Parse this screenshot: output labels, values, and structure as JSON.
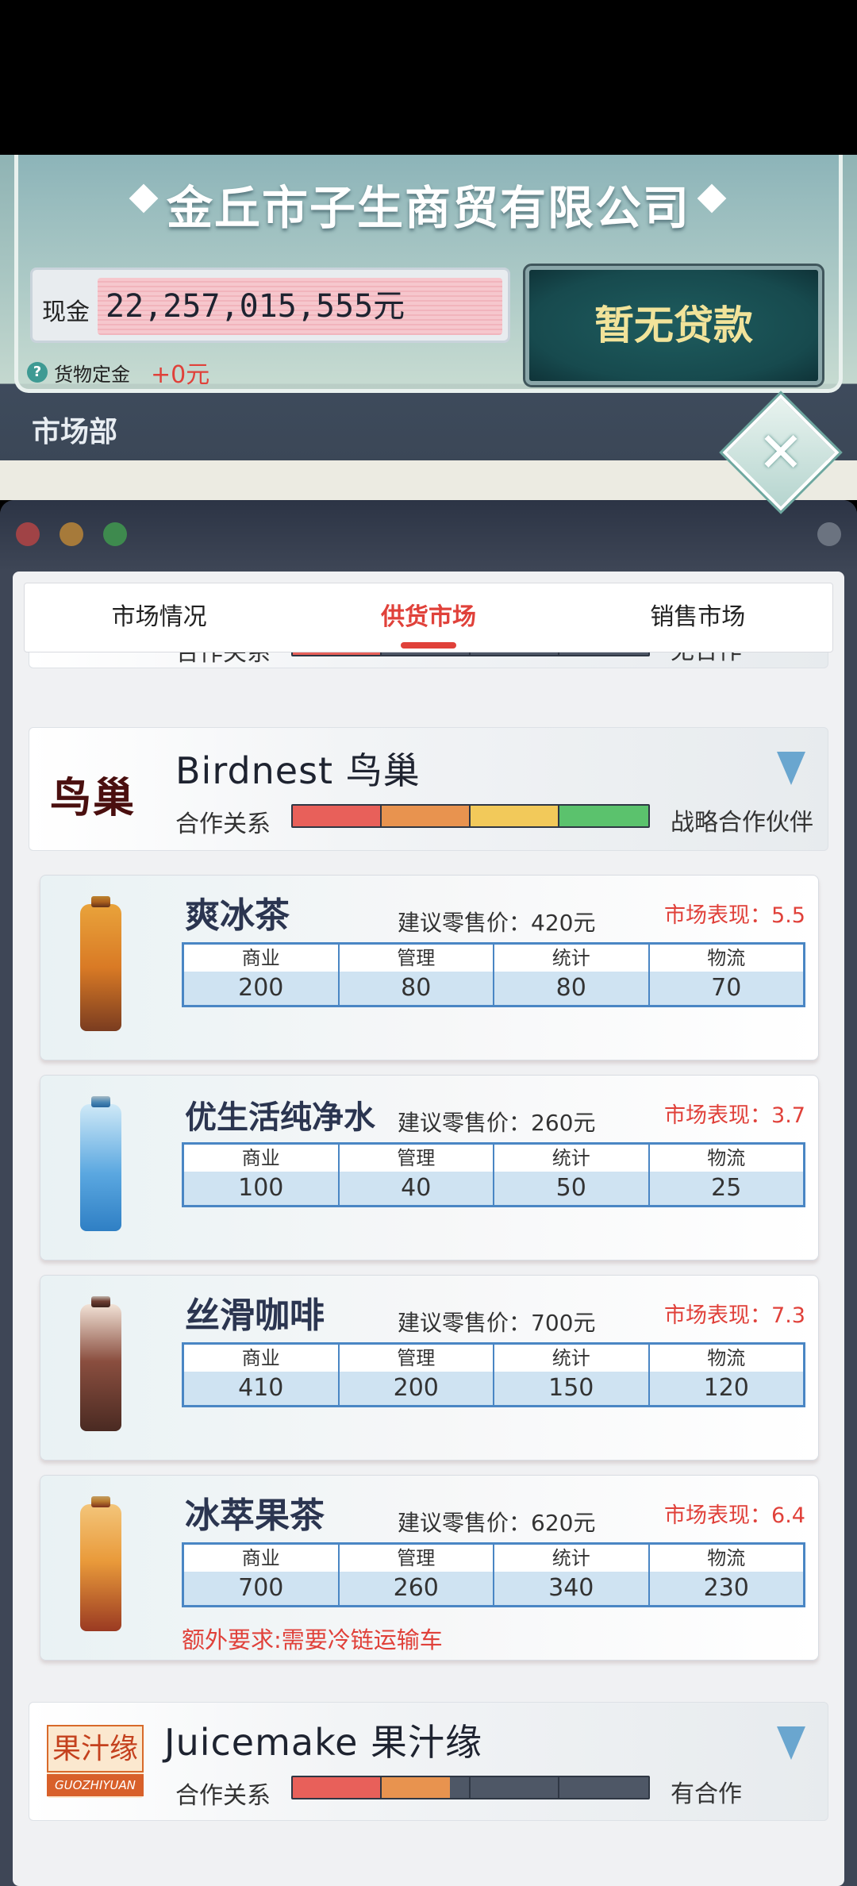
{
  "header": {
    "company_name": "金丘市子生商贸有限公司",
    "cash_label": "现金",
    "cash_value": "22,257,015,555元",
    "loan_button": "暂无贷款",
    "deposit_label": "货物定金",
    "deposit_amount": "+0元",
    "department": "市场部",
    "close": "✕"
  },
  "tabs": [
    {
      "label": "市场情况",
      "active": false
    },
    {
      "label": "供货市场",
      "active": true
    },
    {
      "label": "销售市场",
      "active": false
    }
  ],
  "partial_brand": {
    "relation_label": "合作关系",
    "relation_level": 1,
    "relation_status": "无合作"
  },
  "brands": [
    {
      "logo": "鸟巢",
      "name": "Birdnest 鸟巢",
      "relation_label": "合作关系",
      "relation_level": 4,
      "relation_status": "战略合作伙伴",
      "products": [
        {
          "name": "爽冰茶",
          "price": "建议零售价：420元",
          "performance": "市场表现：5.5",
          "stats": [
            "200",
            "80",
            "80",
            "70"
          ],
          "extra": ""
        },
        {
          "name": "优生活纯净水",
          "price": "建议零售价：260元",
          "performance": "市场表现：3.7",
          "stats": [
            "100",
            "40",
            "50",
            "25"
          ],
          "extra": ""
        },
        {
          "name": "丝滑咖啡",
          "price": "建议零售价：700元",
          "performance": "市场表现：7.3",
          "stats": [
            "410",
            "200",
            "150",
            "120"
          ],
          "extra": ""
        },
        {
          "name": "冰萃果茶",
          "price": "建议零售价：620元",
          "performance": "市场表现：6.4",
          "stats": [
            "700",
            "260",
            "340",
            "230"
          ],
          "extra": "额外要求:需要冷链运输车"
        }
      ]
    },
    {
      "logo": "果汁缘",
      "logo_sub": "GUOZHIYUAN",
      "name": "Juicemake 果汁缘",
      "relation_label": "合作关系",
      "relation_level": 1.7,
      "relation_status": "有合作"
    }
  ],
  "stat_headers": [
    "商业",
    "管理",
    "统计",
    "物流"
  ],
  "colors": {
    "accent": "#e0413a",
    "bar_red": "#e8605a",
    "bar_orange": "#e8934f",
    "bar_yellow": "#f2c95a",
    "bar_green": "#5bc26d",
    "bar_empty": "#4e5766"
  },
  "icons": {
    "help": "question-circle-icon",
    "close": "close-x-icon",
    "expand": "chevron-down-icon"
  }
}
